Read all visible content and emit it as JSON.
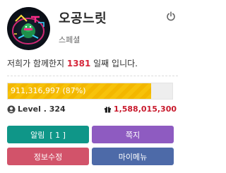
{
  "profile": {
    "name": "오공느릿",
    "rank": "스페셜"
  },
  "welcome": {
    "prefix": "저희가 함께한지 ",
    "days": "1381",
    "suffix": " 일째 입니다."
  },
  "exp": {
    "label": "911,316,997 (87%)",
    "percent": 87,
    "color": "#f7c20a"
  },
  "level": {
    "label": "Level . 324"
  },
  "points": {
    "label": "1,588,015,300"
  },
  "buttons": {
    "alarm": "알림  [ 1 ]",
    "memo": "쪽지",
    "modify": "정보수정",
    "my_menu": "마이메뉴"
  },
  "colors": {
    "alarm": "#0f9688",
    "memo": "#8e5bc1",
    "modify": "#d2536a",
    "my_menu": "#4d6aa8",
    "days": "#d6263a",
    "points": "#c8192c"
  },
  "icons": {
    "power": "power-icon",
    "user": "user-circle-icon",
    "gift": "gift-icon"
  }
}
